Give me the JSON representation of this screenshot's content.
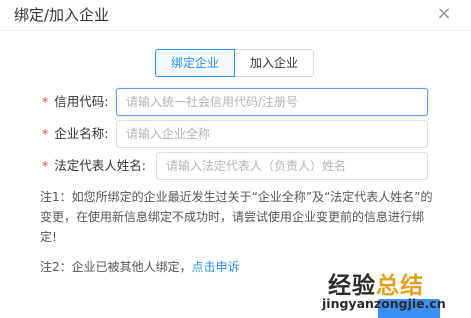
{
  "dialog": {
    "title": "绑定/加入企业",
    "close_symbol": "×"
  },
  "tabs": [
    {
      "label": "绑定企业",
      "active": true
    },
    {
      "label": "加入企业",
      "active": false
    }
  ],
  "form": {
    "required_mark": "*",
    "credit_code": {
      "label": "信用代码:",
      "placeholder": "请输入统一社会信用代码/注册号",
      "value": ""
    },
    "company_name": {
      "label": "企业名称:",
      "placeholder": "请输入企业全称",
      "value": ""
    },
    "legal_rep": {
      "label": "法定代表人姓名:",
      "placeholder": "请输入法定代表人（负责人）姓名",
      "value": ""
    }
  },
  "notes": {
    "note1": "注1：如您所绑定的企业最近发生过关于“企业全称”及“法定代表人姓名”的变更，在使用新信息绑定不成功时，请尝试使用企业变更前的信息进行绑定!",
    "note2_prefix": "注2：企业已被其他人绑定，",
    "note2_link": "点击申诉"
  },
  "watermark": {
    "main_plain": "经验",
    "main_highlight": "总结",
    "sub": "jingyanzongjie.cn"
  },
  "colors": {
    "primary": "#2f8ef4",
    "required": "#e8423b",
    "watermark_accent": "#e3a21a"
  }
}
